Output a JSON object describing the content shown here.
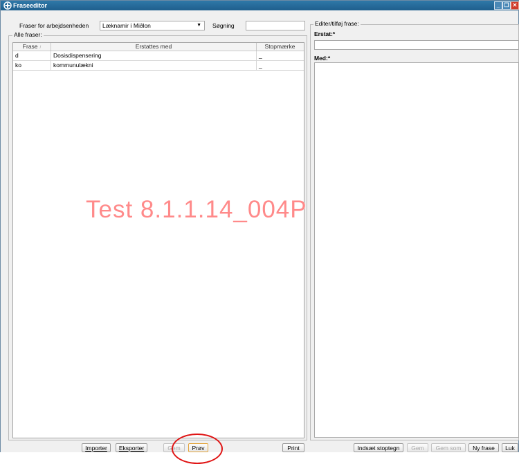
{
  "window": {
    "title": "Fraseeditor"
  },
  "filter": {
    "workunit_label": "Fraser for arbejdsenheden",
    "workunit_value": "Læknamir í Miðlon",
    "search_label": "Søgning",
    "search_value": ""
  },
  "list_group": {
    "legend": "Alle fraser:",
    "columns": [
      "Frase",
      "Erstattes med",
      "Stopmærke"
    ],
    "rows": [
      {
        "frase": "d",
        "erstat": "Dosisdispensering",
        "stop": "_"
      },
      {
        "frase": "ko",
        "erstat": "kommunulækni",
        "stop": "_"
      }
    ]
  },
  "edit_group": {
    "legend": "Editer/tilføj frase:",
    "erstat_label": "Erstat:*",
    "erstat_value": "",
    "med_label": "Med:*",
    "med_value": ""
  },
  "left_buttons": {
    "import": "Importer",
    "export": "Eksporter",
    "gem": "Gem",
    "prov": "Prøv",
    "print": "Print"
  },
  "right_buttons": {
    "insert_stop": "Indsæt stoptegn",
    "gem": "Gem",
    "gem_som": "Gem som",
    "ny_frase": "Ny frase",
    "luk": "Luk"
  },
  "watermark": "Test 8.1.1.14_004P",
  "colors": {
    "titlebar": "#1f5f8d",
    "annotation": "#e01515",
    "watermark": "#ff8a8a"
  }
}
